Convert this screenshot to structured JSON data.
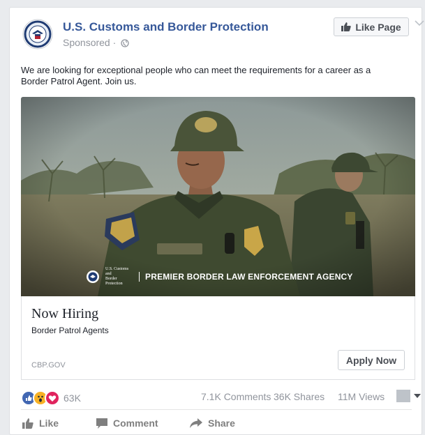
{
  "post": {
    "page_name": "U.S. Customs and Border Protection",
    "sponsored_label": "Sponsored",
    "separator": "·",
    "like_page_label": "Like Page",
    "text": "We are looking for exceptional people who can meet the requirements for a career as a Border Patrol Agent. Join us."
  },
  "image": {
    "seal_line1": "U.S. Customs and",
    "seal_line2": "Border Protection",
    "tagline": "PREMIER BORDER LAW ENFORCEMENT AGENCY"
  },
  "card": {
    "title": "Now Hiring",
    "subtitle": "Border Patrol Agents",
    "domain": "CBP.GOV",
    "cta_label": "Apply Now"
  },
  "stats": {
    "reaction_count": "63K",
    "comments": "7.1K Comments",
    "shares": "36K Shares",
    "views": "11M Views"
  },
  "actions": {
    "like": "Like",
    "comment": "Comment",
    "share": "Share"
  },
  "icons": {
    "globe": "globe-icon",
    "thumbs_up": "thumbs-up-icon",
    "chevron": "chevron-down-icon",
    "comment": "comment-icon",
    "share": "share-icon",
    "reactions": [
      "like-reaction-icon",
      "wow-reaction-icon",
      "love-reaction-icon"
    ]
  },
  "colors": {
    "link_blue": "#365899",
    "muted_text": "#90949c",
    "like_reaction": "#4267b2",
    "wow_reaction": "#f7b125",
    "love_reaction": "#e0245e",
    "uniform_green": "#3f4a30"
  }
}
